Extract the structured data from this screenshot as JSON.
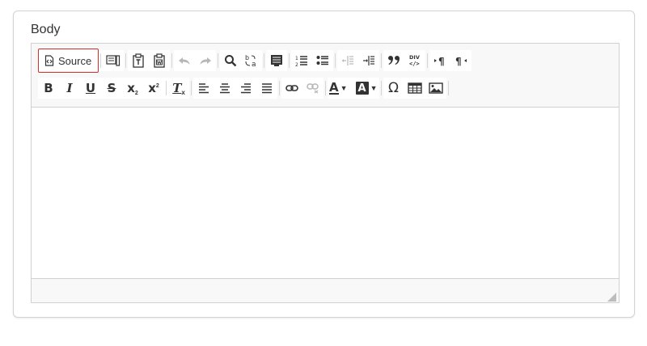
{
  "field": {
    "label": "Body"
  },
  "toolbar": {
    "source_label": "Source",
    "icons": {
      "source": "source-icon",
      "preview": "preview-icon",
      "paste_text": "paste-as-text-icon",
      "paste_word": "paste-from-word-icon",
      "undo": "undo-icon",
      "redo": "redo-icon",
      "find": "find-icon",
      "replace": "replace-icon",
      "select_all": "select-all-icon",
      "numbered_list": "numbered-list-icon",
      "bulleted_list": "bulleted-list-icon",
      "outdent": "outdent-icon",
      "indent": "indent-icon",
      "blockquote": "blockquote-icon",
      "div": "create-div-icon",
      "ltr": "text-direction-ltr-icon",
      "rtl": "text-direction-rtl-icon",
      "link": "link-icon",
      "unlink": "unlink-icon",
      "special_char": "special-character-icon",
      "table": "table-icon",
      "image": "image-icon"
    },
    "format": {
      "bold": "B",
      "italic": "I",
      "underline": "U",
      "strike": "S",
      "subscript": "x",
      "superscript": "x",
      "remove_format": "T",
      "text_color": "A",
      "bg_color": "A",
      "special_char": "Ω"
    }
  },
  "editor": {
    "content": ""
  },
  "colors": {
    "accent_focus": "#d0312d",
    "toolbar_bg": "#f8f8f8",
    "border": "#d1d1d1"
  }
}
